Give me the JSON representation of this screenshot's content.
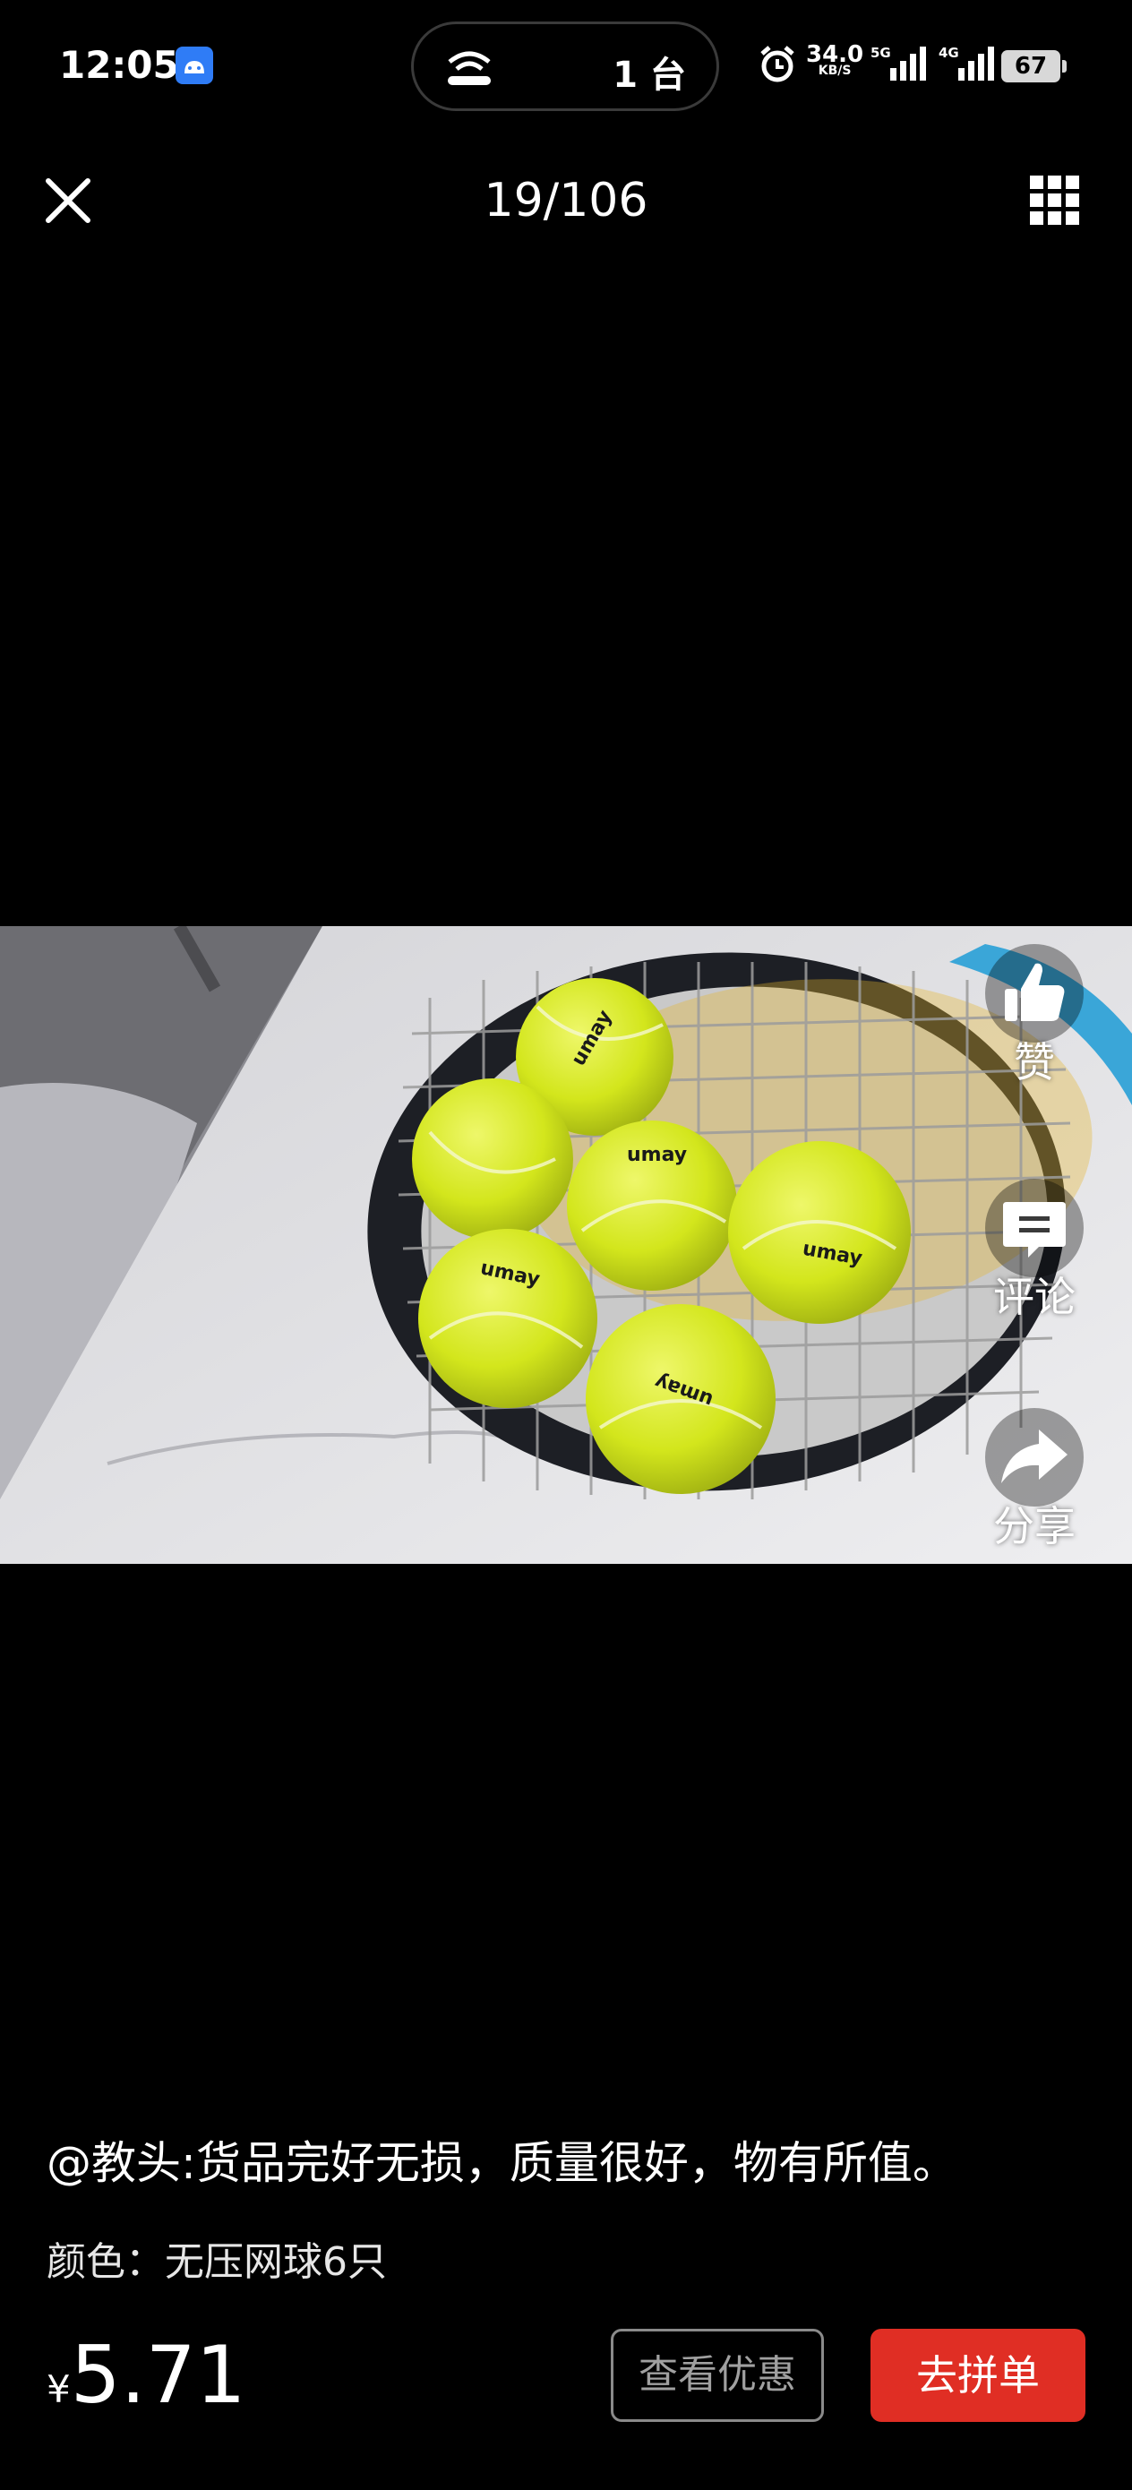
{
  "status_bar": {
    "time": "12:05",
    "cast_count": "1 台",
    "net_speed_value": "34.0",
    "net_speed_unit": "KB/S",
    "signal_1": "5G",
    "signal_2": "4G",
    "battery": "67"
  },
  "header": {
    "counter": "19/106",
    "close_icon": "close-icon",
    "grid_icon": "grid-icon"
  },
  "side_actions": {
    "like_label": "赞",
    "comment_label": "评论",
    "share_label": "分享"
  },
  "review": {
    "text": "@教头:货品完好无损，质量很好，物有所值。",
    "variant": "颜色：无压网球6只"
  },
  "footer": {
    "currency": "¥",
    "price": "5.71",
    "coupon_button": "查看优惠",
    "group_button": "去拼单"
  },
  "colors": {
    "accent_red": "#e02e24",
    "ball_yellow": "#d8ea1c",
    "background": "#000000"
  },
  "photo": {
    "ball_brand_text": "umay"
  }
}
